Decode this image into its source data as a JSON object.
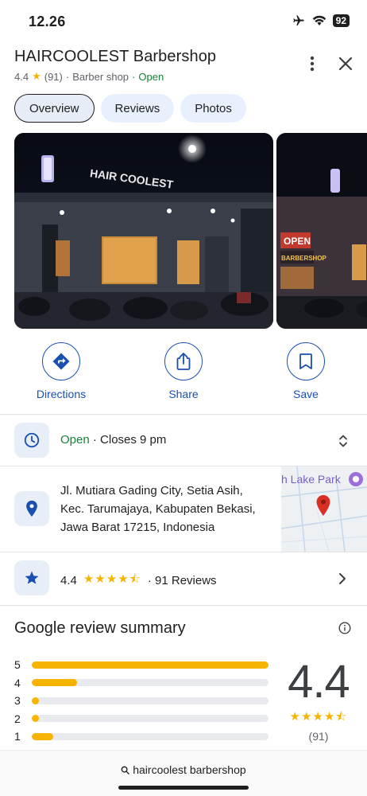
{
  "status_bar": {
    "time": "12.26",
    "battery": "92",
    "icons": [
      "airplane-icon",
      "wifi-icon",
      "battery-icon"
    ]
  },
  "place": {
    "name": "HAIRCOOLEST Barbershop",
    "rating": "4.4",
    "review_count": "(91)",
    "category": "Barber shop",
    "status": "Open",
    "separator": "·"
  },
  "tabs": [
    {
      "label": "Overview",
      "active": true
    },
    {
      "label": "Reviews",
      "active": false
    },
    {
      "label": "Photos",
      "active": false
    }
  ],
  "photos": {
    "main_sign": "HAIR COOLEST",
    "second_sign_1": "OPEN",
    "second_sign_2": "BARBERSHOP"
  },
  "actions": [
    {
      "label": "Directions",
      "icon": "directions-icon"
    },
    {
      "label": "Share",
      "icon": "share-icon"
    },
    {
      "label": "Save",
      "icon": "bookmark-icon"
    }
  ],
  "hours": {
    "status": "Open",
    "closes": " · Closes 9 pm"
  },
  "address": {
    "line1": "Jl. Mutiara Gading City, Setia Asih,",
    "line2": "Kec. Tarumajaya, Kabupaten Bekasi,",
    "line3": "Jawa Barat 17215, Indonesia",
    "map_label": "h Lake Park"
  },
  "rating_row": {
    "rating": "4.4",
    "stars": "★★★★⯪",
    "reviews": "· 91 Reviews"
  },
  "summary": {
    "title": "Google review summary",
    "distribution": [
      {
        "star": "5",
        "fraction": 1.0
      },
      {
        "star": "4",
        "fraction": 0.19
      },
      {
        "star": "3",
        "fraction": 0.03
      },
      {
        "star": "2",
        "fraction": 0.03
      },
      {
        "star": "1",
        "fraction": 0.09
      }
    ],
    "average": "4.4",
    "stars": "★★★★⯪",
    "count": "(91)"
  },
  "browser": {
    "url": "haircoolest barbershop"
  },
  "colors": {
    "accent_blue": "#1a4fb0",
    "open_green": "#188038",
    "star_yellow": "#f6b400",
    "map_pin_red": "#d93025"
  }
}
